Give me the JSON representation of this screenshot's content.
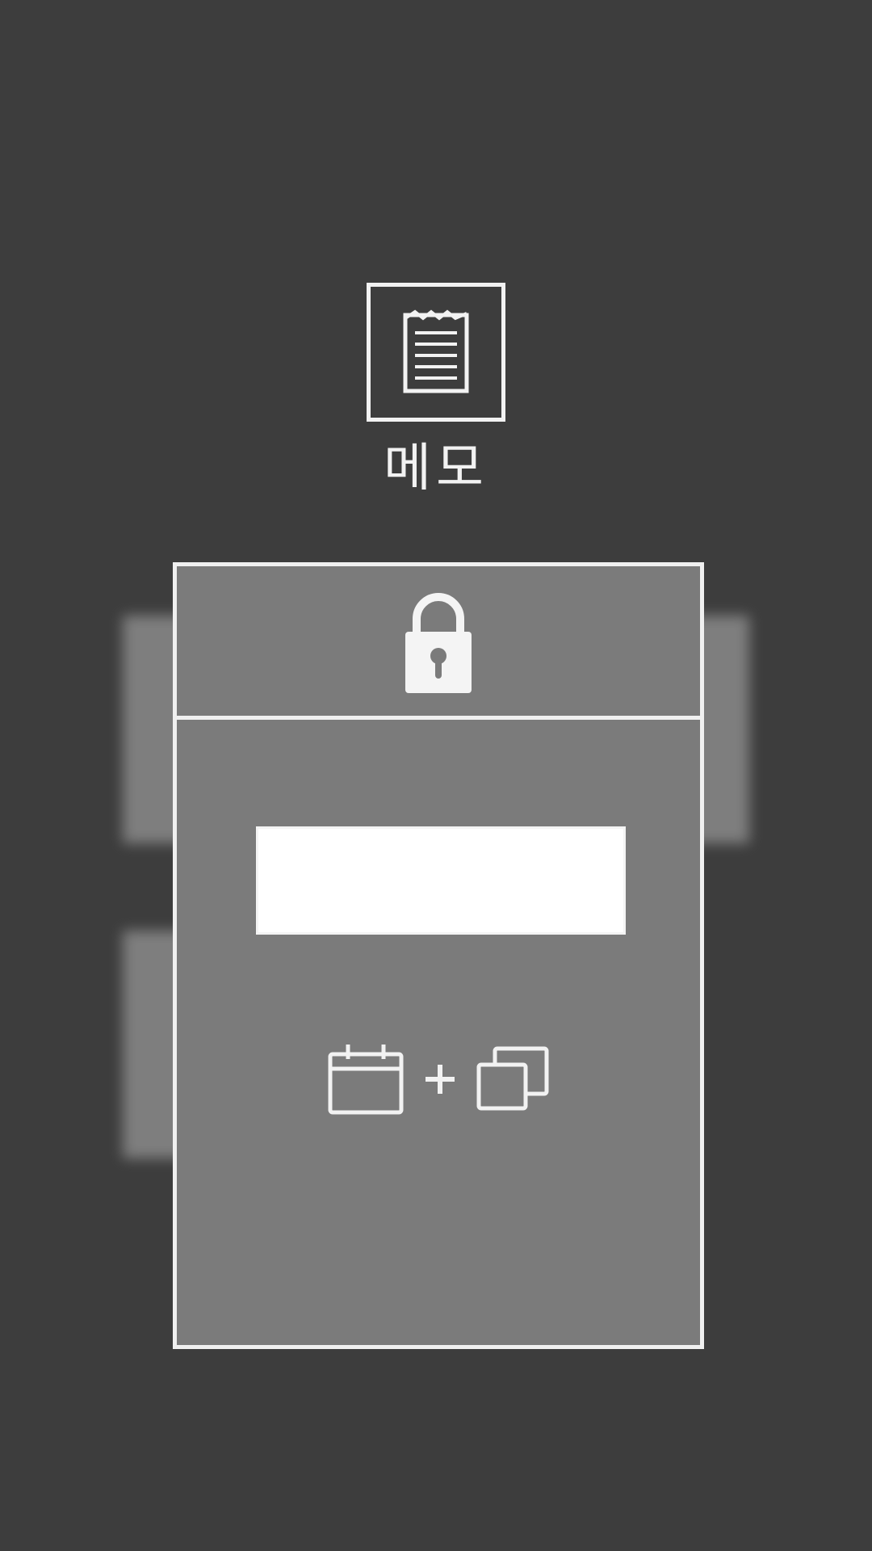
{
  "app": {
    "label": "메모",
    "icon": "notepad-icon"
  },
  "lock_card": {
    "icon": "lock-icon",
    "password_input": {
      "value": "",
      "placeholder": ""
    },
    "actions": [
      {
        "icon": "calendar-icon"
      },
      {
        "icon": "plus-icon"
      },
      {
        "icon": "copy-windows-icon"
      }
    ]
  },
  "colors": {
    "background": "#3d3d3d",
    "card": "#7b7b7b",
    "stroke": "#f0f0f0",
    "input": "#ffffff"
  }
}
